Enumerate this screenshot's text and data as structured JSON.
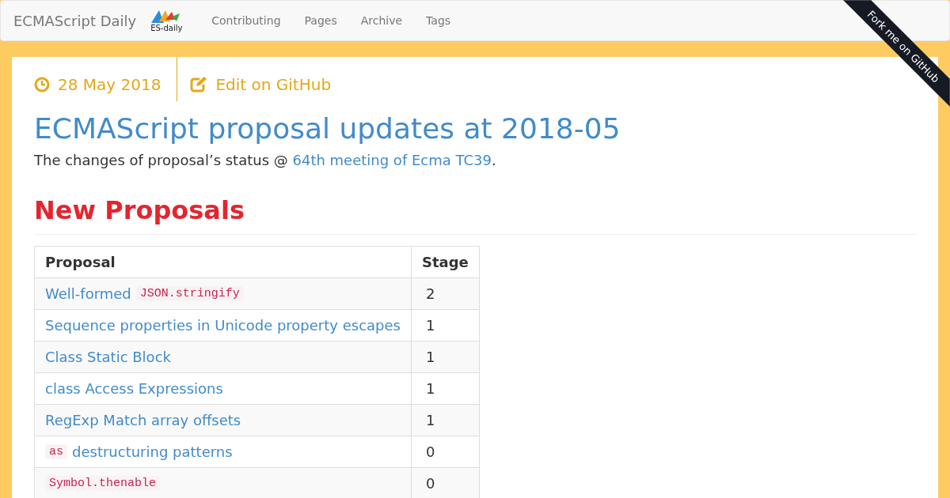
{
  "navbar": {
    "brand": "ECMAScript Daily",
    "logo_text": "ES-daily",
    "links": [
      "Contributing",
      "Pages",
      "Archive",
      "Tags"
    ]
  },
  "ribbon": {
    "text": "Fork me on GitHub"
  },
  "post": {
    "date": "28 May 2018",
    "edit_link": "Edit on GitHub",
    "title": "ECMAScript proposal updates at 2018-05",
    "intro_text": "The changes of proposal’s status @ ",
    "intro_link": "64th meeting of Ecma TC39",
    "intro_end": "."
  },
  "section": {
    "heading": "New Proposals",
    "table": {
      "columns": [
        "Proposal",
        "Stage"
      ],
      "rows": [
        {
          "proposal": [
            {
              "kind": "link",
              "text": "Well-formed"
            },
            {
              "kind": "code",
              "text": "JSON.stringify"
            }
          ],
          "stage": "2"
        },
        {
          "proposal": [
            {
              "kind": "link",
              "text": "Sequence properties in Unicode property escapes"
            }
          ],
          "stage": "1"
        },
        {
          "proposal": [
            {
              "kind": "link",
              "text": "Class Static Block"
            }
          ],
          "stage": "1"
        },
        {
          "proposal": [
            {
              "kind": "link",
              "text": "class Access Expressions"
            }
          ],
          "stage": "1"
        },
        {
          "proposal": [
            {
              "kind": "link",
              "text": "RegExp Match array offsets"
            }
          ],
          "stage": "1"
        },
        {
          "proposal": [
            {
              "kind": "code",
              "text": "as"
            },
            {
              "kind": "link",
              "text": "destructuring patterns"
            }
          ],
          "stage": "0"
        },
        {
          "proposal": [
            {
              "kind": "code",
              "text": "Symbol.thenable"
            }
          ],
          "stage": "0"
        }
      ]
    }
  }
}
